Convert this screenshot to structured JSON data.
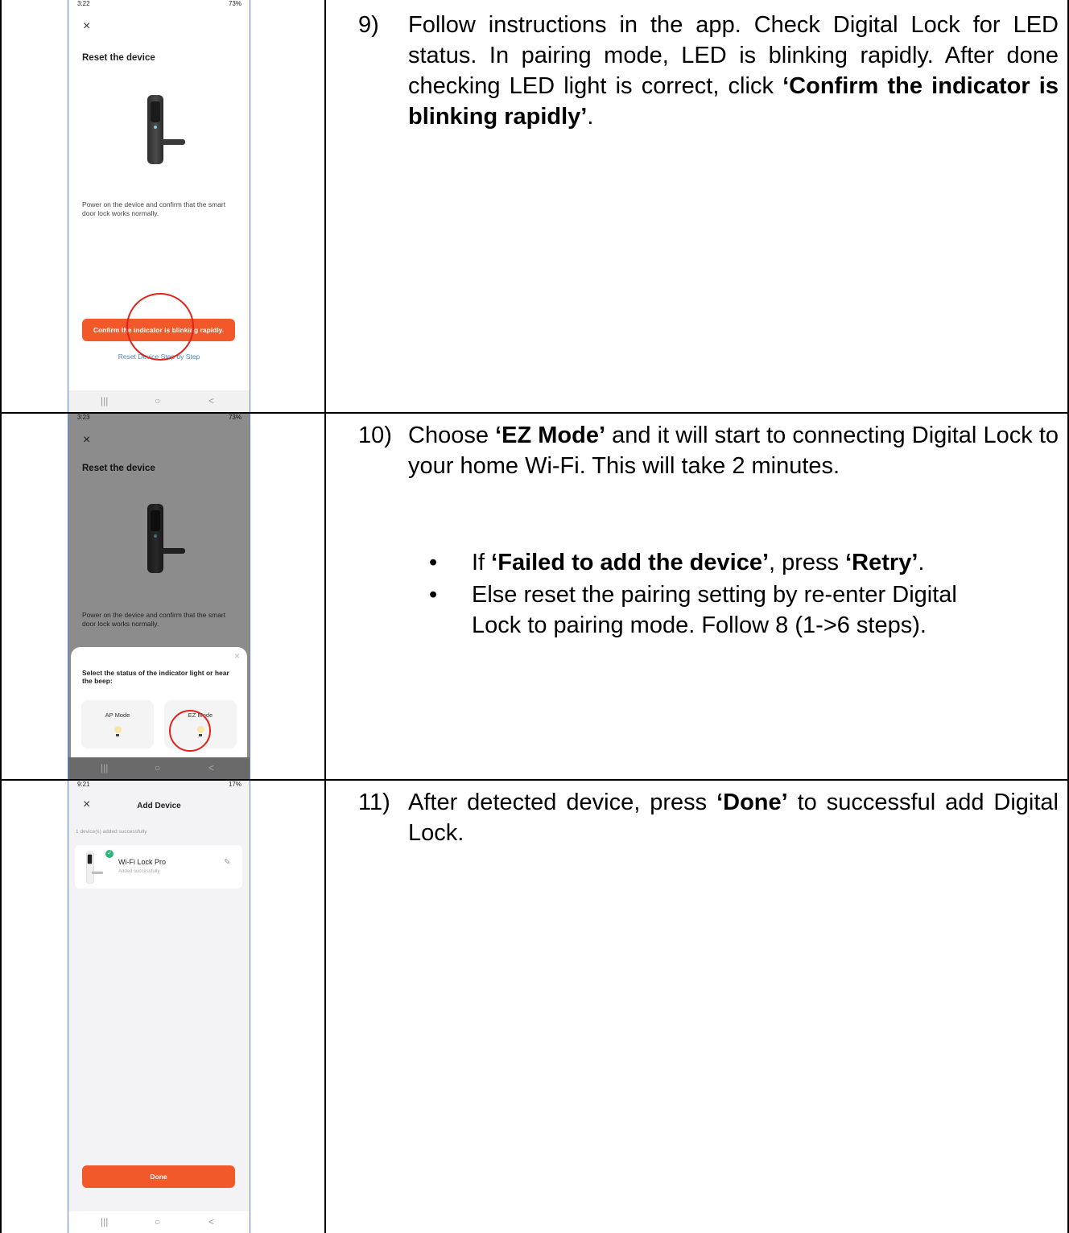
{
  "rows": [
    {
      "phone": {
        "time": "3:22",
        "status_right": "73%",
        "close": "×",
        "title": "Reset the device",
        "description": "Power on the device and confirm that the smart door lock works normally.",
        "confirm_button": "Confirm the indicator is blinking rapidly.",
        "link": "Reset Device Step by Step",
        "nav": [
          "|||",
          "○",
          "<"
        ]
      },
      "step": {
        "number": "9)",
        "text_before": "Follow instructions in the app. Check Digital Lock for LED status. In pairing mode, LED is blinking rapidly. After done checking LED light is correct, click ",
        "bold": "‘Confirm the indicator is blinking rapidly’",
        "text_after": "."
      }
    },
    {
      "phone": {
        "time": "3:23",
        "status_right": "73%",
        "close": "×",
        "title": "Reset the device",
        "description": "Power on the device and confirm that the smart door lock works normally.",
        "sheet_close": "×",
        "sheet_title": "Select the status of the indicator light or hear the beep:",
        "modes": [
          "AP Mode",
          "EZ Mode"
        ],
        "nav": [
          "|||",
          "○",
          "<"
        ]
      },
      "step": {
        "number": "10)",
        "t1": "Choose ",
        "b1": "‘EZ Mode’",
        "t2": " and it will start to connecting Digital Lock to your home Wi-Fi. This will take 2 minutes.",
        "bullets": [
          {
            "t1": "If ",
            "b1": "‘Failed to add the device’",
            "t2": ", press ",
            "b2": "‘Retry’",
            "t3": "."
          },
          {
            "t1": "Else reset the pairing setting by re-enter Digital Lock to pairing mode. Follow 8 (1->6 steps)."
          }
        ],
        "bullet_symbol": "•"
      }
    },
    {
      "phone": {
        "time": "9:21",
        "status_right": "17%",
        "close": "×",
        "title": "Add Device",
        "success_count": "1 device(s) added successfully",
        "device_name": "Wi-Fi Lock Pro",
        "device_status": "Added successfully",
        "done_button": "Done",
        "nav": [
          "|||",
          "○",
          "<"
        ]
      },
      "step": {
        "number": "11)",
        "t1": "After detected device, press ",
        "b1": "‘Done’",
        "t2": " to successful add Digital Lock."
      }
    }
  ],
  "colors": {
    "accent": "#f1592a",
    "link": "#3b8ad6",
    "annotation_circle": "#e0231b"
  }
}
